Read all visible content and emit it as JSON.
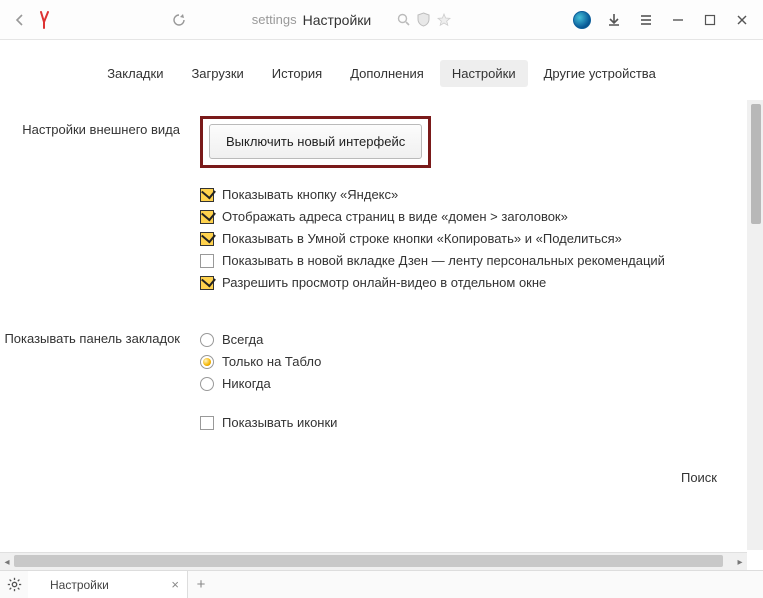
{
  "titlebar": {
    "address_label": "settings",
    "address_title": "Настройки"
  },
  "nav": {
    "items": [
      {
        "label": "Закладки",
        "active": false
      },
      {
        "label": "Загрузки",
        "active": false
      },
      {
        "label": "История",
        "active": false
      },
      {
        "label": "Дополнения",
        "active": false
      },
      {
        "label": "Настройки",
        "active": true
      },
      {
        "label": "Другие устройства",
        "active": false
      }
    ]
  },
  "sections": {
    "appearance": {
      "title": "Настройки внешнего вида",
      "button": "Выключить новый интерфейс",
      "options": [
        {
          "label": "Показывать кнопку «Яндекс»",
          "checked": true
        },
        {
          "label": "Отображать адреса страниц в виде «домен > заголовок»",
          "checked": true
        },
        {
          "label": "Показывать в Умной строке кнопки «Копировать» и «Поделиться»",
          "checked": true
        },
        {
          "label": "Показывать в новой вкладке Дзен — ленту персональных рекомендаций",
          "checked": false
        },
        {
          "label": "Разрешить просмотр онлайн-видео в отдельном окне",
          "checked": true
        }
      ]
    },
    "bookmarks_panel": {
      "title": "Показывать панель закладок",
      "radios": [
        {
          "label": "Всегда",
          "checked": false
        },
        {
          "label": "Только на Табло",
          "checked": true
        },
        {
          "label": "Никогда",
          "checked": false
        }
      ],
      "show_icons": {
        "label": "Показывать иконки",
        "checked": false
      }
    },
    "cutoff_label": "Поиск"
  },
  "tabstrip": {
    "tab_title": "Настройки"
  }
}
